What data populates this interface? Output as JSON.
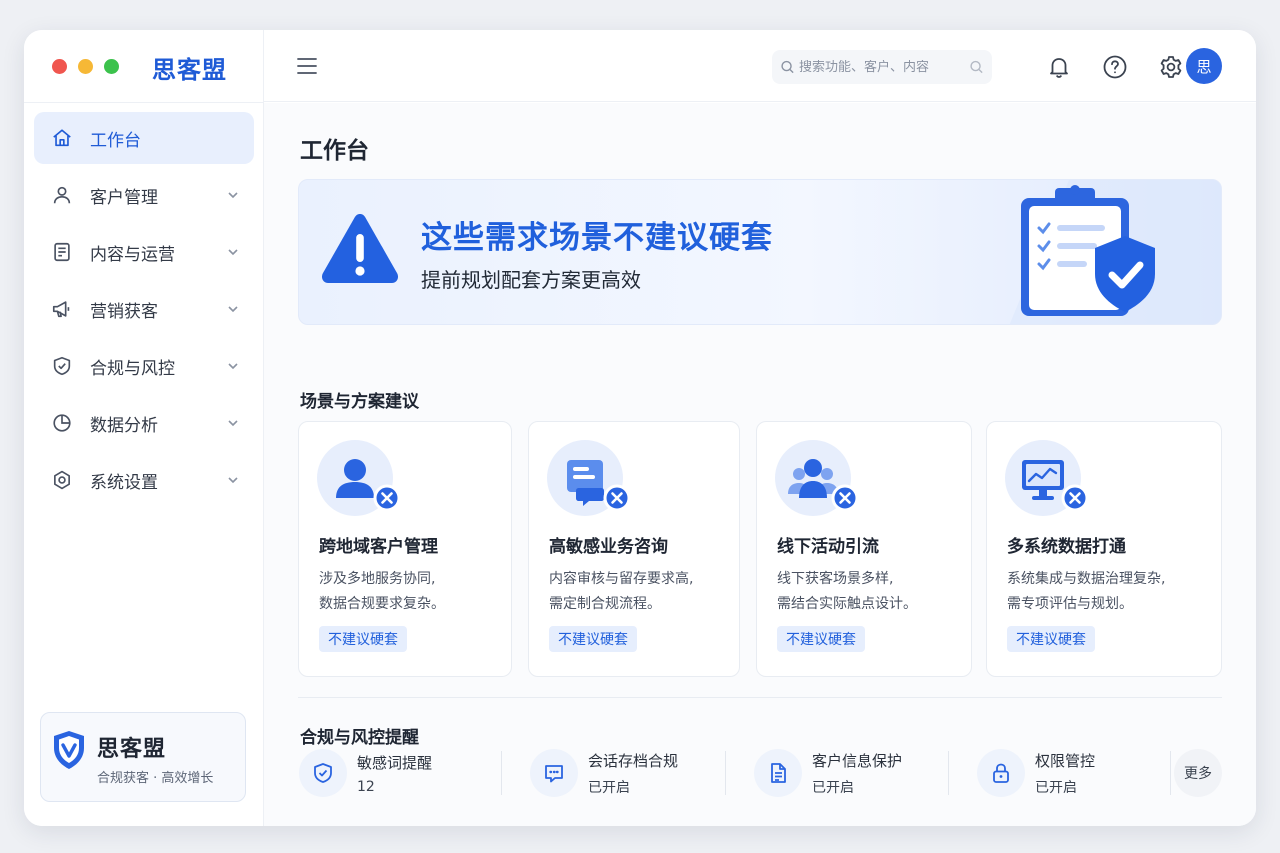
{
  "app": {
    "brand": "思客盟"
  },
  "header": {
    "search_placeholder": "搜索功能、客户、内容",
    "avatar_text": "思"
  },
  "sidebar": {
    "items": [
      {
        "label": "工作台",
        "icon": "home-icon",
        "active": true
      },
      {
        "label": "客户管理",
        "icon": "user-icon"
      },
      {
        "label": "内容与运营",
        "icon": "document-icon"
      },
      {
        "label": "营销获客",
        "icon": "megaphone-icon"
      },
      {
        "label": "合规与风控",
        "icon": "shield-check-icon"
      },
      {
        "label": "数据分析",
        "icon": "pie-chart-icon"
      },
      {
        "label": "系统设置",
        "icon": "gear-icon"
      }
    ],
    "brand_card": {
      "name": "思客盟",
      "slogan": "合规获客 · 高效增长"
    }
  },
  "main": {
    "title": "工作台",
    "banner": {
      "title": "这些需求场景不建议硬套",
      "subtitle": "提前规划配套方案更高效"
    },
    "scenarios_title": "场景与方案建议",
    "scenarios": [
      {
        "title": "跨地域客户管理",
        "line1": "涉及多地服务协同,",
        "line2": "数据合规要求复杂。",
        "tag": "不建议硬套",
        "icon": "person-icon"
      },
      {
        "title": "高敏感业务咨询",
        "line1": "内容审核与留存要求高,",
        "line2": "需定制合规流程。",
        "tag": "不建议硬套",
        "icon": "chat-icon"
      },
      {
        "title": "线下活动引流",
        "line1": "线下获客场景多样,",
        "line2": "需结合实际触点设计。",
        "tag": "不建议硬套",
        "icon": "group-icon"
      },
      {
        "title": "多系统数据打通",
        "line1": "系统集成与数据治理复杂,",
        "line2": "需专项评估与规划。",
        "tag": "不建议硬套",
        "icon": "monitor-chart-icon"
      }
    ],
    "compliance_title": "合规与风控提醒",
    "compliance": [
      {
        "label": "敏感词提醒",
        "value": "12",
        "icon": "shield-check-icon"
      },
      {
        "label": "会话存档合规",
        "value": "已开启",
        "icon": "message-icon"
      },
      {
        "label": "客户信息保护",
        "value": "已开启",
        "icon": "file-icon"
      },
      {
        "label": "权限管控",
        "value": "已开启",
        "icon": "lock-icon"
      }
    ],
    "more_label": "更多"
  },
  "colors": {
    "accent": "#2a64e0",
    "accent_light": "#e8effd"
  }
}
